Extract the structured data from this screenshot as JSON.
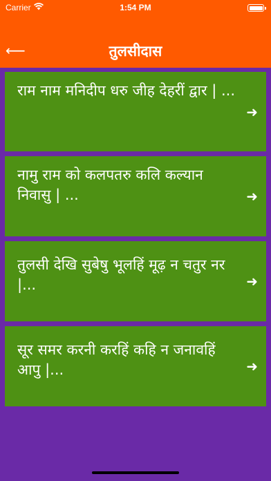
{
  "status_bar": {
    "carrier": "Carrier",
    "time": "1:54 PM"
  },
  "header": {
    "title": "तुलसीदास",
    "back_icon": "arrow-left-icon",
    "color": "#ff5a00"
  },
  "colors": {
    "background": "#6a2aa7",
    "card": "#4e9114",
    "text": "#ffffff"
  },
  "items": [
    {
      "text": "राम नाम  मनिदीप धरु जीह देहरीं द्वार | ...",
      "icon": "arrow-right-icon"
    },
    {
      "text": "नामु राम  को कलपतरु कलि कल्यान निवासु | ...",
      "icon": "arrow-right-icon"
    },
    {
      "text": "तुलसी देखि सुबेषु भूलहिं मूढ़ न चतुर नर |...",
      "icon": "arrow-right-icon"
    },
    {
      "text": "सूर समर करनी करहिं कहि न जनावहिं आपु |...",
      "icon": "arrow-right-icon"
    }
  ]
}
